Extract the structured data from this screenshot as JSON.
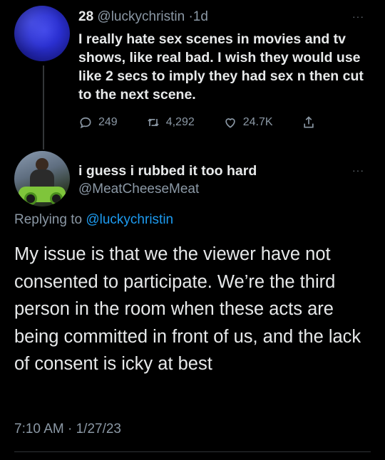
{
  "parent_tweet": {
    "display_name": "28",
    "handle": "@luckychristin",
    "separator": "·",
    "time": "1d",
    "text": "I really hate sex scenes in movies and tv shows, like real bad. I wish they would use like 2 secs to imply they had sex n then cut to the next scene.",
    "replies": "249",
    "retweets": "4,292",
    "likes": "24.7K",
    "more": "···"
  },
  "reply_tweet": {
    "display_name": "i guess i rubbed it too hard",
    "handle": "@MeatCheeseMeat",
    "replying_prefix": "Replying to",
    "replying_to": "@luckychristin",
    "text": "My issue is that we the viewer have not consented to participate. We’re the third person in the room when these acts are being committed in front of us, and the lack of consent is icky at best",
    "timestamp": "7:10 AM · 1/27/23",
    "more": "···"
  },
  "colors": {
    "background": "#000000",
    "text": "#e7e9ea",
    "secondary": "#8b98a5",
    "link": "#1d9bf0",
    "divider": "#2f3336"
  },
  "icons": {
    "reply": "speech-bubble-icon",
    "retweet": "retweet-icon",
    "like": "heart-icon",
    "share": "share-icon"
  }
}
